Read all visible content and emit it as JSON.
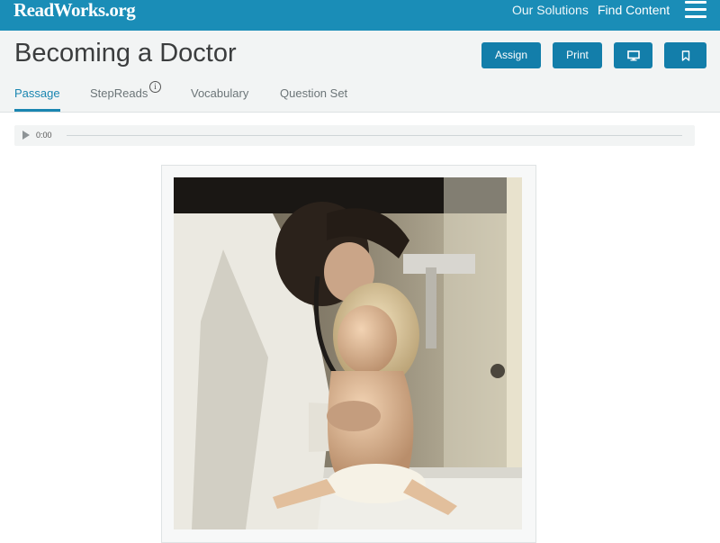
{
  "brand": {
    "logo_text": "ReadWorks.org"
  },
  "topnav": {
    "our_solutions": "Our Solutions",
    "find_content": "Find Content",
    "menu_icon": "hamburger-menu-icon"
  },
  "page": {
    "title": "Becoming a Doctor"
  },
  "actions": {
    "assign": "Assign",
    "print": "Print",
    "present_icon": "monitor-icon",
    "bookmark_icon": "bookmark-icon"
  },
  "tabs": [
    {
      "label": "Passage",
      "active": true
    },
    {
      "label": "StepReads",
      "info_icon": "i"
    },
    {
      "label": "Vocabulary"
    },
    {
      "label": "Question Set"
    }
  ],
  "audio": {
    "time": "0:00",
    "play_icon": "play-icon"
  },
  "colors": {
    "brand_blue": "#1a8db7",
    "button_blue": "#137eaa",
    "active_tab": "#1a86b1"
  }
}
